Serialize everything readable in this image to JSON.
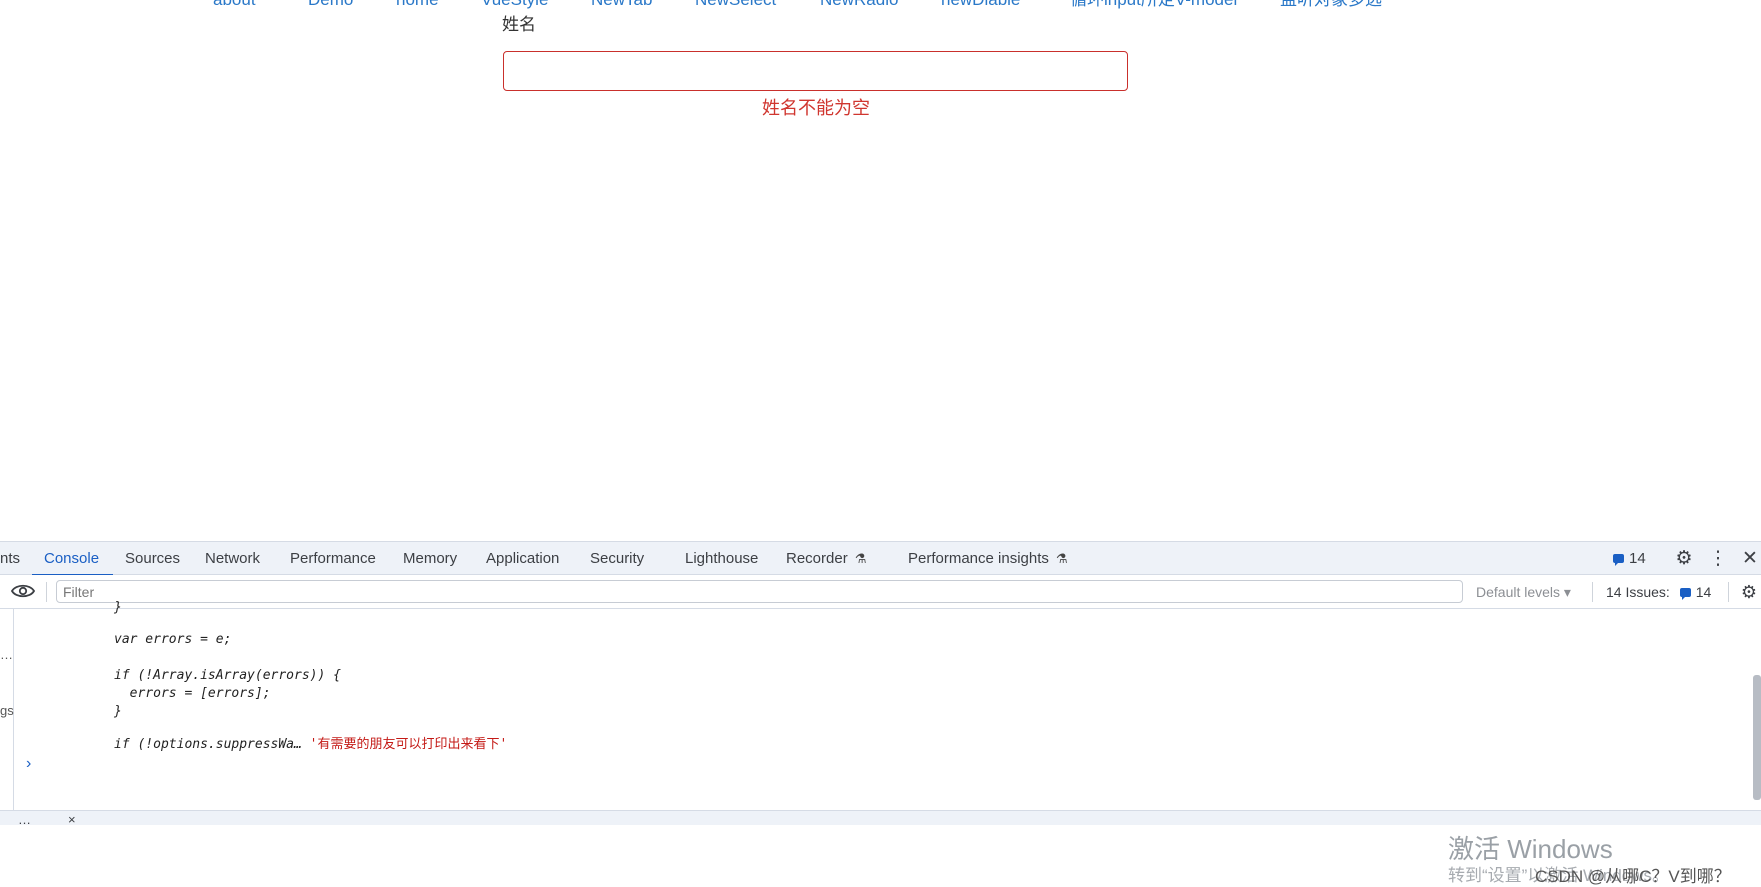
{
  "top_nav": {
    "links": [
      "about",
      "Demo",
      "home",
      "VueStyle",
      "NewTab",
      "NewSelect",
      "NewRadio",
      "newDiable",
      "循环input所定V-model",
      "监听对象多选"
    ]
  },
  "form": {
    "label": "姓名",
    "input_value": "",
    "error": "姓名不能为空"
  },
  "devtools": {
    "tabs": [
      "nts",
      "Console",
      "Sources",
      "Network",
      "Performance",
      "Memory",
      "Application",
      "Security",
      "Lighthouse",
      "Recorder",
      "Performance insights"
    ],
    "active_tab": "Console",
    "issues_badge": "14",
    "filter_placeholder": "Filter",
    "levels_label": "Default levels ▾",
    "issues_label": "14 Issues:",
    "issues_count": "14",
    "code_lines": [
      "}",
      "var errors = e;",
      "if (!Array.isArray(errors)) {",
      "  errors = [errors];",
      "}",
      "if (!options.suppressWa…"
    ],
    "code_string": "'有需要的朋友可以打印出来看下'",
    "prompt": "›",
    "sidebar_fragments": [
      "…",
      "gs"
    ],
    "bottom_label": "…",
    "bottom_close": "×"
  },
  "overlay": {
    "activate_title": "激活 Windows",
    "activate_sub": "转到“设置”以激活 Windows。",
    "csdn": "CSDN @从哪C？V到哪？"
  },
  "colors": {
    "link": "#2a78c8",
    "error": "#d0362f",
    "devtools_bg": "#eef2f8",
    "accent": "#1a5fc4"
  }
}
